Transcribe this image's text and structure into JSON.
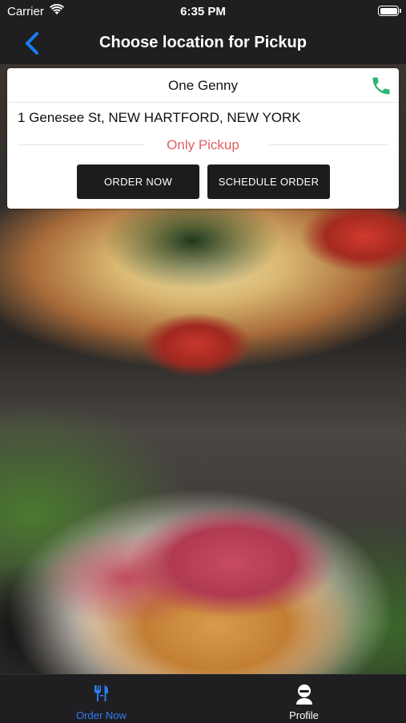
{
  "status_bar": {
    "carrier": "Carrier",
    "time": "6:35 PM",
    "icons": [
      "wifi-icon",
      "battery-icon"
    ]
  },
  "nav": {
    "title": "Choose location for Pickup",
    "back_icon": "chevron-left-icon",
    "accent": "#1a7cf5"
  },
  "location": {
    "name": "One Genny",
    "address": "1 Genesee St, NEW HARTFORD, NEW YORK",
    "mode": "Only Pickup",
    "mode_color": "#e06060",
    "phone_icon": "phone-icon",
    "phone_color": "#2bb673",
    "buttons": {
      "order_now": "ORDER NOW",
      "schedule_order": "SCHEDULE ORDER"
    }
  },
  "background_image": "food photo: pizza and seared tuna salad",
  "tabbar": {
    "tabs": [
      {
        "label": "Order Now",
        "icon": "fork-knife-icon",
        "active": true,
        "color": "#2f7cf6"
      },
      {
        "label": "Profile",
        "icon": "person-icon",
        "active": false,
        "color": "#ffffff"
      }
    ]
  }
}
